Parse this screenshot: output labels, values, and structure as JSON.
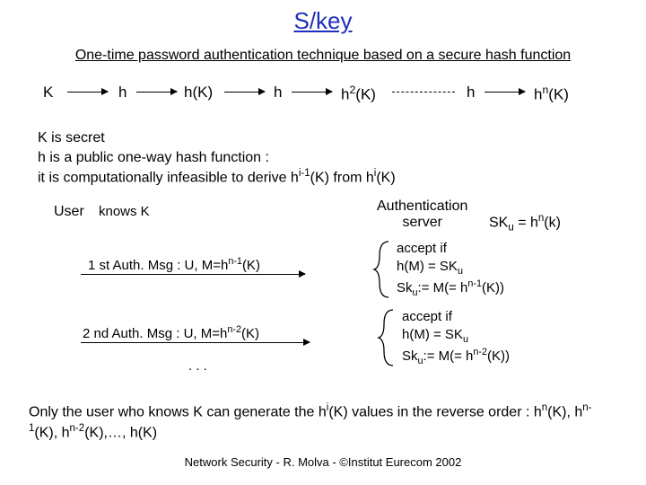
{
  "title": "S/key",
  "subtitle": "One-time password authentication technique based on a secure hash function",
  "chain": {
    "K": "K",
    "h1": "h",
    "hK": "h(K)",
    "h2": "h",
    "h2K": "h²(K)",
    "h3": "h",
    "hnK": "hⁿ(K)"
  },
  "desc_line1": "K is secret",
  "desc_line2": "h is a public one-way hash function :",
  "desc_line3_a": "it is computationally infeasible to derive h",
  "desc_line3_sup": "i-1",
  "desc_line3_b": "(K) from h",
  "desc_line3_sup2": "i",
  "desc_line3_c": "(K)",
  "user_label": "User",
  "user_knows": "knows K",
  "auth_server": "Authentication\nserver",
  "sku_eq_a": "SK",
  "sku_eq_sub": "u",
  "sku_eq_b": " = h",
  "sku_eq_sup": "n",
  "sku_eq_c": "(k)",
  "msg1_a": "1 st Auth. Msg : U, M=h",
  "msg1_sup": "n-1",
  "msg1_b": "(K)",
  "msg2_a": "2 nd Auth. Msg : U, M=h",
  "msg2_sup": "n-2",
  "msg2_b": "(K)",
  "accept1_l1": "accept if",
  "accept1_l2a": "h(M) = SK",
  "accept1_l2sub": "u",
  "accept1_l3a": "Sk",
  "accept1_l3sub": "u",
  "accept1_l3b": ":= M(= h",
  "accept1_l3sup": "n-1",
  "accept1_l3c": "(K))",
  "accept2_l3sup": "n-2",
  "dots": ". . .",
  "concl_a": "Only the user who knows K can generate the h",
  "concl_sup": "i",
  "concl_b": "(K) values in the reverse order :    h",
  "concl_s1": "n",
  "concl_c": "(K), h",
  "concl_s2": "n-1",
  "concl_d": "(K), h",
  "concl_s3": "n-2",
  "concl_e": "(K),…, h(K)",
  "footer": "Network Security - R. Molva - ©Institut Eurecom 2002"
}
